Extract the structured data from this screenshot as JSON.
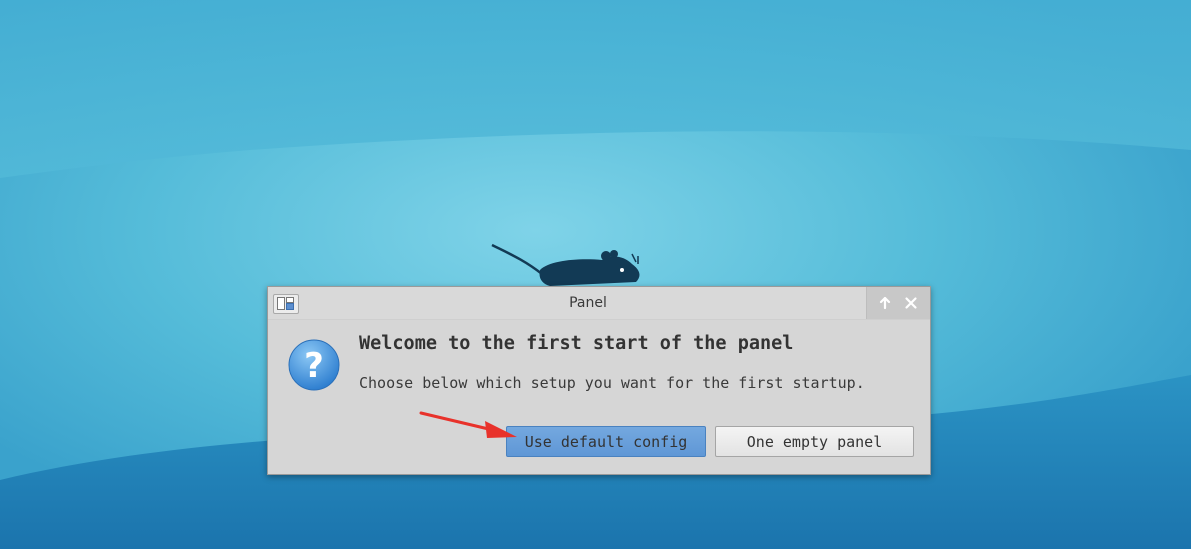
{
  "desktop": {
    "background_colors": {
      "base": "#3fa6cf",
      "highlight": "#74cbe3",
      "bottom": "#1f7fb3"
    }
  },
  "dialog": {
    "title": "Panel",
    "heading": "Welcome to the first start of the panel",
    "message": "Choose below which setup you want for the first startup.",
    "icon": "question-icon",
    "buttons": {
      "default_config": "Use default config",
      "empty_panel": "One empty panel"
    },
    "titlebar_icons": [
      "arrow-up-icon",
      "close-icon"
    ]
  },
  "annotation": {
    "arrow_color": "#e8322b"
  }
}
